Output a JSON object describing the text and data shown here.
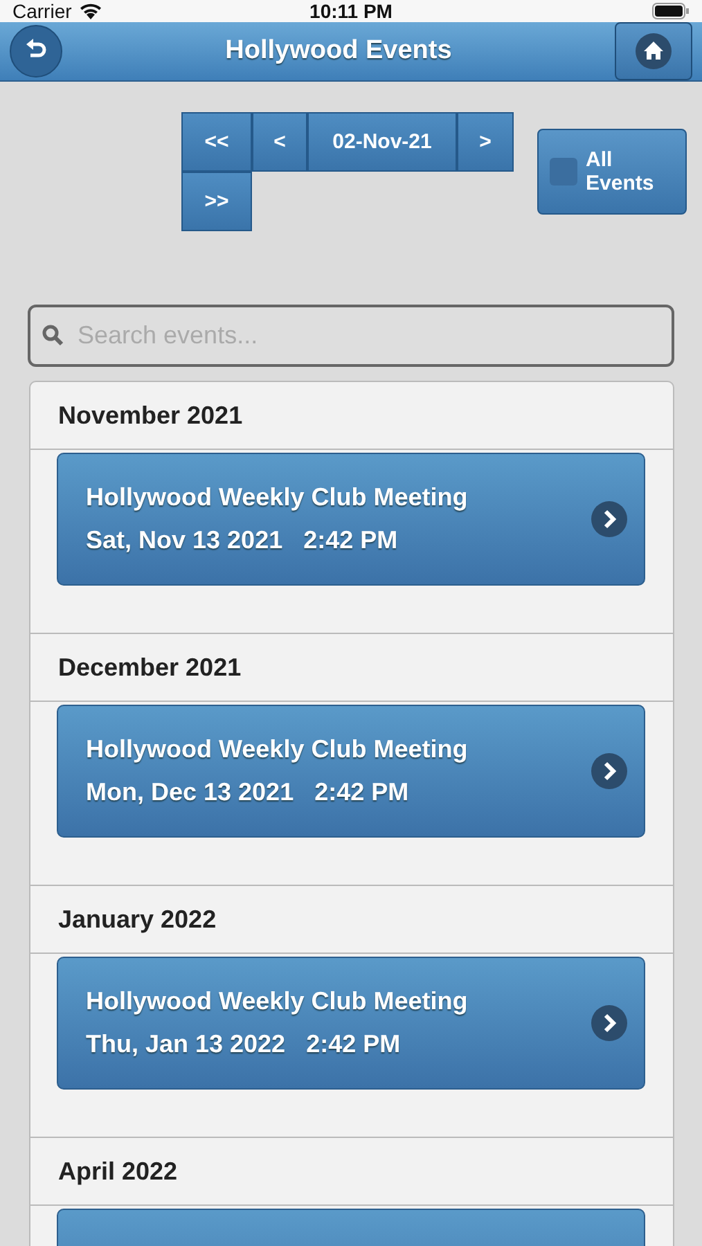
{
  "status_bar": {
    "carrier": "Carrier",
    "time": "10:11 PM"
  },
  "header": {
    "title": "Hollywood Events"
  },
  "date_nav": {
    "buttons": [
      "<<",
      "<",
      "02-Nov-21",
      ">",
      ">>"
    ]
  },
  "all_events": {
    "label": "All Events",
    "checked": false
  },
  "search": {
    "placeholder": "Search events..."
  },
  "groups": [
    {
      "heading": "November 2021",
      "events": [
        {
          "kind": "event",
          "title": "Hollywood Weekly Club Meeting",
          "when": "Sat, Nov 13 2021   2:42 PM"
        }
      ]
    },
    {
      "heading": "December 2021",
      "events": [
        {
          "kind": "event",
          "title": "Hollywood Weekly Club Meeting",
          "when": "Mon, Dec 13 2021   2:42 PM"
        }
      ]
    },
    {
      "heading": "January 2022",
      "events": [
        {
          "kind": "event",
          "title": "Hollywood Weekly Club Meeting",
          "when": "Thu, Jan 13 2022   2:42 PM"
        }
      ]
    },
    {
      "heading": "April 2022",
      "events": [
        {
          "kind": "partial"
        }
      ]
    }
  ]
}
